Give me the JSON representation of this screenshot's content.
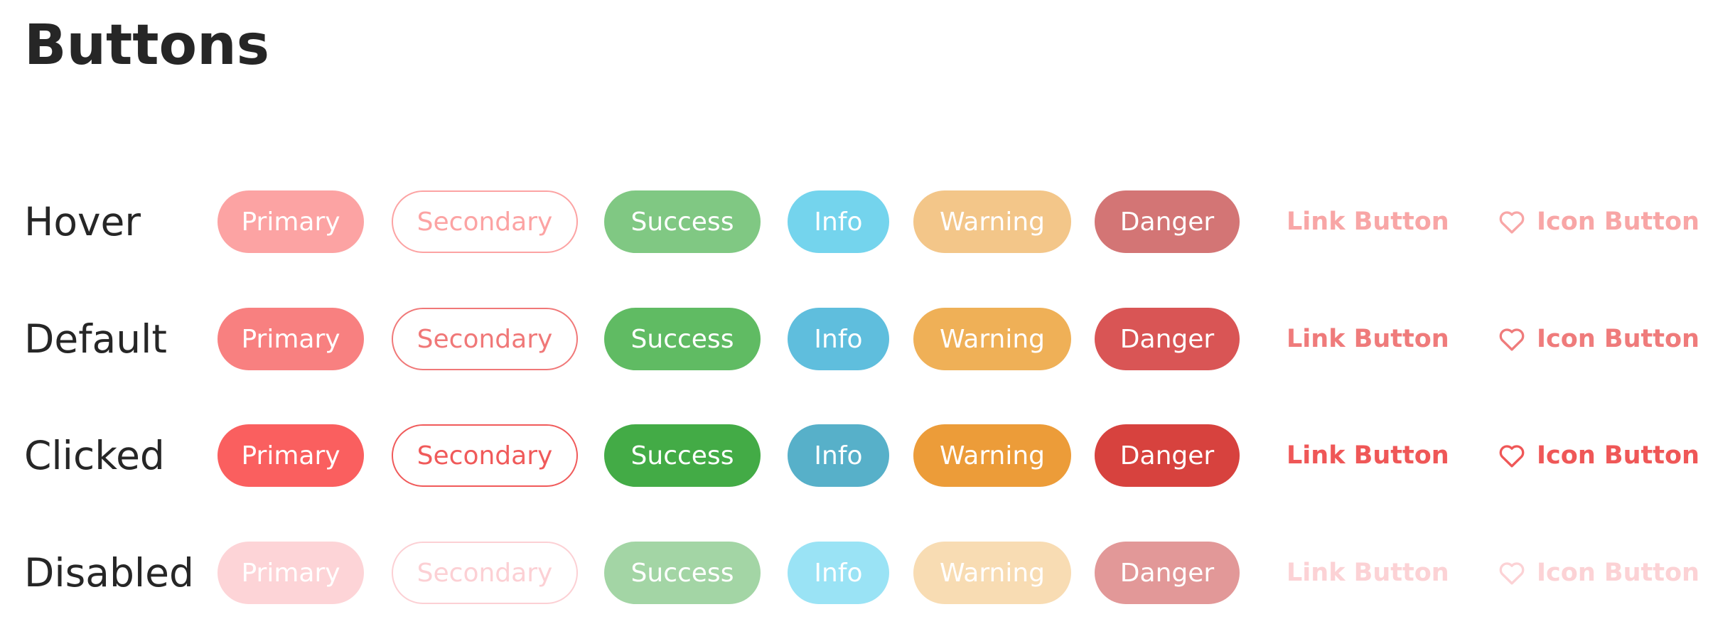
{
  "page": {
    "title": "Buttons"
  },
  "labels": {
    "primary": "Primary",
    "secondary": "Secondary",
    "success": "Success",
    "info": "Info",
    "warning": "Warning",
    "danger": "Danger",
    "link": "Link Button",
    "icon_button": "Icon Button",
    "icon_name": "heart-icon"
  },
  "states": [
    {
      "label": "Hover",
      "colors": {
        "primary": "#fca3a3",
        "secondary": "#fca3a3",
        "success": "#80c883",
        "info": "#74d4ed",
        "warning": "#f3c689",
        "danger": "#d37575",
        "link": "#f8a6a6"
      }
    },
    {
      "label": "Default",
      "colors": {
        "primary": "#f88080",
        "secondary": "#f07878",
        "success": "#60bb63",
        "info": "#5fbedd",
        "warning": "#efb057",
        "danger": "#d95555",
        "link": "#ef7b7b"
      }
    },
    {
      "label": "Clicked",
      "colors": {
        "primary": "#fa5f5f",
        "secondary": "#f05a5a",
        "success": "#43ab46",
        "info": "#57b0c9",
        "warning": "#ec9c39",
        "danger": "#d7423e",
        "link": "#ef5757"
      }
    },
    {
      "label": "Disabled",
      "colors": {
        "primary": "#fdd4d7",
        "secondary": "#fcd0d4",
        "success": "#a3d5a5",
        "info": "#9ae3f5",
        "warning": "#f8dcb3",
        "danger": "#e29898",
        "link": "#fcd2d5"
      }
    }
  ]
}
